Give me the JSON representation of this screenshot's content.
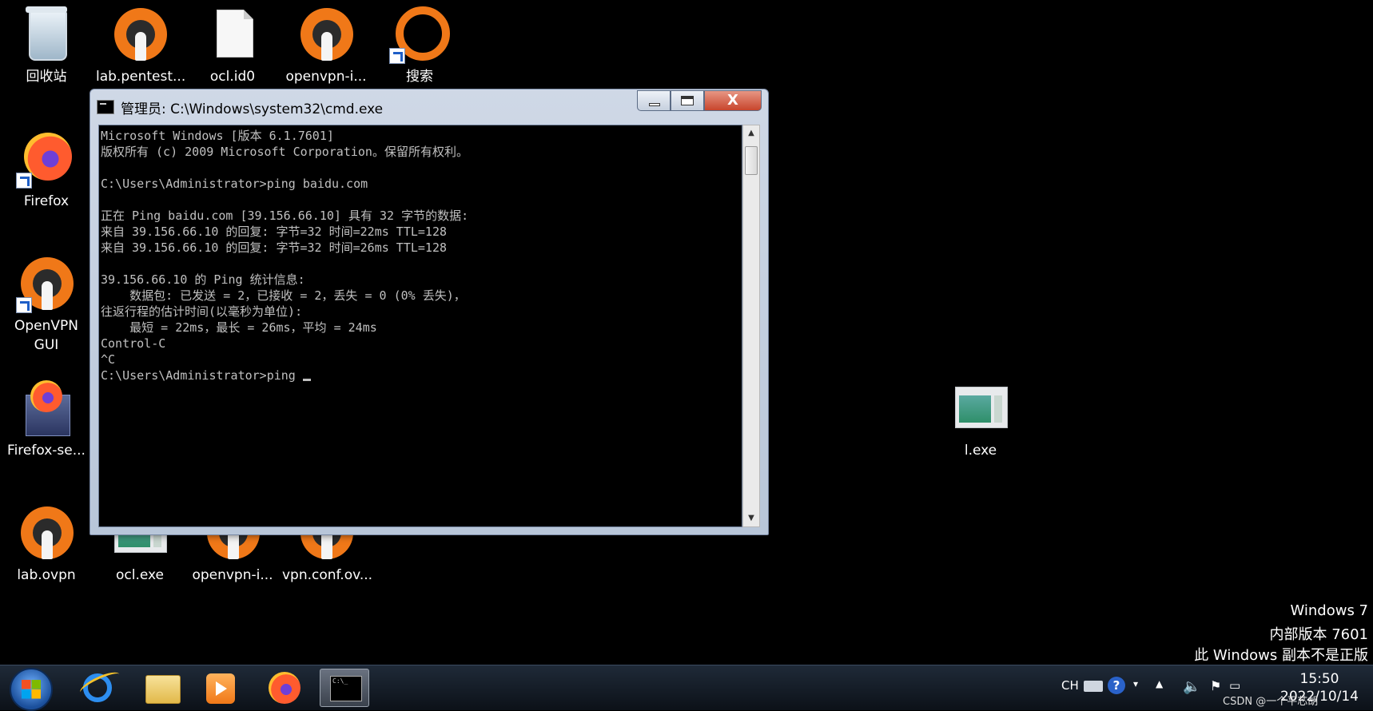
{
  "desktop": {
    "icons": [
      {
        "label": "回收站"
      },
      {
        "label": "lab.pentest..."
      },
      {
        "label": "ocl.id0"
      },
      {
        "label": "openvpn-i..."
      },
      {
        "label": "搜索"
      },
      {
        "label": "Firefox"
      },
      {
        "label": "OpenVPN GUI"
      },
      {
        "label": "Firefox-se..."
      },
      {
        "label": "lab.ovpn"
      },
      {
        "label": "ocl.exe"
      },
      {
        "label": "openvpn-i..."
      },
      {
        "label": "vpn.conf.ov..."
      },
      {
        "label": "l.exe"
      }
    ]
  },
  "cmd_window": {
    "title": "管理员: C:\\Windows\\system32\\cmd.exe",
    "close_glyph": "X",
    "console_text": "Microsoft Windows [版本 6.1.7601]\n版权所有 (c) 2009 Microsoft Corporation。保留所有权利。\n\nC:\\Users\\Administrator>ping baidu.com\n\n正在 Ping baidu.com [39.156.66.10] 具有 32 字节的数据:\n来自 39.156.66.10 的回复: 字节=32 时间=22ms TTL=128\n来自 39.156.66.10 的回复: 字节=32 时间=26ms TTL=128\n\n39.156.66.10 的 Ping 统计信息:\n    数据包: 已发送 = 2，已接收 = 2，丢失 = 0 (0% 丢失)，\n往返行程的估计时间(以毫秒为单位):\n    最短 = 22ms，最长 = 26ms，平均 = 24ms\nControl-C\n^C\nC:\\Users\\Administrator>ping "
  },
  "watermark": {
    "line1": "Windows 7",
    "line2": "内部版本 7601",
    "line3": "此 Windows 副本不是正版"
  },
  "taskbar": {
    "pinned": [
      {
        "icon": "start-orb-icon"
      },
      {
        "icon": "internet-explorer-icon"
      },
      {
        "icon": "file-explorer-icon"
      },
      {
        "icon": "media-player-icon"
      },
      {
        "icon": "firefox-icon"
      },
      {
        "icon": "cmd-icon"
      }
    ],
    "tray": {
      "lang": "CH",
      "help": "?",
      "time": "15:50",
      "date": "2022/10/14",
      "overlay_text": "CSDN @一个平芯胡"
    }
  }
}
